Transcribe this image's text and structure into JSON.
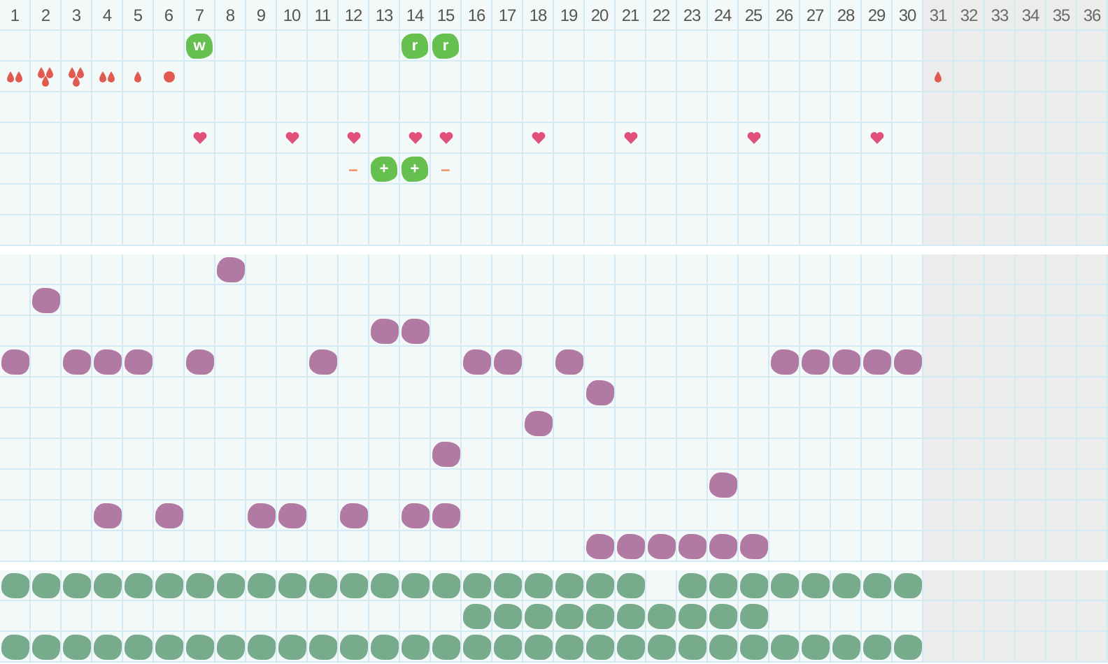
{
  "days": [
    {
      "label": "1",
      "disabled": false
    },
    {
      "label": "2",
      "disabled": false
    },
    {
      "label": "3",
      "disabled": false
    },
    {
      "label": "4",
      "disabled": false
    },
    {
      "label": "5",
      "disabled": false
    },
    {
      "label": "6",
      "disabled": false
    },
    {
      "label": "7",
      "disabled": false
    },
    {
      "label": "8",
      "disabled": false
    },
    {
      "label": "9",
      "disabled": false
    },
    {
      "label": "10",
      "disabled": false
    },
    {
      "label": "11",
      "disabled": false
    },
    {
      "label": "12",
      "disabled": false
    },
    {
      "label": "13",
      "disabled": false
    },
    {
      "label": "14",
      "disabled": false
    },
    {
      "label": "15",
      "disabled": false
    },
    {
      "label": "16",
      "disabled": false
    },
    {
      "label": "17",
      "disabled": false
    },
    {
      "label": "18",
      "disabled": false
    },
    {
      "label": "19",
      "disabled": false
    },
    {
      "label": "20",
      "disabled": false
    },
    {
      "label": "21",
      "disabled": false
    },
    {
      "label": "22",
      "disabled": false
    },
    {
      "label": "23",
      "disabled": false
    },
    {
      "label": "24",
      "disabled": false
    },
    {
      "label": "25",
      "disabled": false
    },
    {
      "label": "26",
      "disabled": false
    },
    {
      "label": "27",
      "disabled": false
    },
    {
      "label": "28",
      "disabled": false
    },
    {
      "label": "29",
      "disabled": false
    },
    {
      "label": "30",
      "disabled": false
    },
    {
      "label": "31",
      "disabled": true
    },
    {
      "label": "32",
      "disabled": true
    },
    {
      "label": "33",
      "disabled": true
    },
    {
      "label": "34",
      "disabled": true
    },
    {
      "label": "35",
      "disabled": true
    },
    {
      "label": "36",
      "disabled": true
    }
  ],
  "symptoms": [
    {
      "cells": [
        {
          "kind": "none"
        },
        {
          "kind": "none"
        },
        {
          "kind": "none"
        },
        {
          "kind": "none"
        },
        {
          "kind": "none"
        },
        {
          "kind": "none"
        },
        {
          "kind": "badge",
          "text": "w"
        },
        {
          "kind": "none"
        },
        {
          "kind": "none"
        },
        {
          "kind": "none"
        },
        {
          "kind": "none"
        },
        {
          "kind": "none"
        },
        {
          "kind": "none"
        },
        {
          "kind": "badge",
          "text": "r"
        },
        {
          "kind": "badge",
          "text": "r"
        },
        {
          "kind": "none"
        },
        {
          "kind": "none"
        },
        {
          "kind": "none"
        },
        {
          "kind": "none"
        },
        {
          "kind": "none"
        },
        {
          "kind": "none"
        },
        {
          "kind": "none"
        },
        {
          "kind": "none"
        },
        {
          "kind": "none"
        },
        {
          "kind": "none"
        },
        {
          "kind": "none"
        },
        {
          "kind": "none"
        },
        {
          "kind": "none"
        },
        {
          "kind": "none"
        },
        {
          "kind": "none"
        },
        {
          "kind": "none"
        },
        {
          "kind": "none"
        },
        {
          "kind": "none"
        },
        {
          "kind": "none"
        },
        {
          "kind": "none"
        },
        {
          "kind": "none"
        }
      ]
    },
    {
      "cells": [
        {
          "kind": "double"
        },
        {
          "kind": "triple"
        },
        {
          "kind": "triple"
        },
        {
          "kind": "double"
        },
        {
          "kind": "single"
        },
        {
          "kind": "spot"
        },
        {
          "kind": "none"
        },
        {
          "kind": "none"
        },
        {
          "kind": "none"
        },
        {
          "kind": "none"
        },
        {
          "kind": "none"
        },
        {
          "kind": "none"
        },
        {
          "kind": "none"
        },
        {
          "kind": "none"
        },
        {
          "kind": "none"
        },
        {
          "kind": "none"
        },
        {
          "kind": "none"
        },
        {
          "kind": "none"
        },
        {
          "kind": "none"
        },
        {
          "kind": "none"
        },
        {
          "kind": "none"
        },
        {
          "kind": "none"
        },
        {
          "kind": "none"
        },
        {
          "kind": "none"
        },
        {
          "kind": "none"
        },
        {
          "kind": "none"
        },
        {
          "kind": "none"
        },
        {
          "kind": "none"
        },
        {
          "kind": "none"
        },
        {
          "kind": "none"
        },
        {
          "kind": "single"
        },
        {
          "kind": "none"
        },
        {
          "kind": "none"
        },
        {
          "kind": "none"
        },
        {
          "kind": "none"
        },
        {
          "kind": "none"
        }
      ]
    },
    {
      "cells": [
        {
          "kind": "none"
        },
        {
          "kind": "none"
        },
        {
          "kind": "none"
        },
        {
          "kind": "none"
        },
        {
          "kind": "none"
        },
        {
          "kind": "none"
        },
        {
          "kind": "none"
        },
        {
          "kind": "none"
        },
        {
          "kind": "none"
        },
        {
          "kind": "none"
        },
        {
          "kind": "none"
        },
        {
          "kind": "none"
        },
        {
          "kind": "none"
        },
        {
          "kind": "none"
        },
        {
          "kind": "none"
        },
        {
          "kind": "none"
        },
        {
          "kind": "none"
        },
        {
          "kind": "none"
        },
        {
          "kind": "none"
        },
        {
          "kind": "none"
        },
        {
          "kind": "none"
        },
        {
          "kind": "none"
        },
        {
          "kind": "none"
        },
        {
          "kind": "none"
        },
        {
          "kind": "none"
        },
        {
          "kind": "none"
        },
        {
          "kind": "none"
        },
        {
          "kind": "none"
        },
        {
          "kind": "none"
        },
        {
          "kind": "none"
        },
        {
          "kind": "none"
        },
        {
          "kind": "none"
        },
        {
          "kind": "none"
        },
        {
          "kind": "none"
        },
        {
          "kind": "none"
        },
        {
          "kind": "none"
        }
      ]
    },
    {
      "cells": [
        {
          "kind": "none"
        },
        {
          "kind": "none"
        },
        {
          "kind": "none"
        },
        {
          "kind": "none"
        },
        {
          "kind": "none"
        },
        {
          "kind": "none"
        },
        {
          "kind": "heart"
        },
        {
          "kind": "none"
        },
        {
          "kind": "none"
        },
        {
          "kind": "heart"
        },
        {
          "kind": "none"
        },
        {
          "kind": "heart"
        },
        {
          "kind": "none"
        },
        {
          "kind": "heart"
        },
        {
          "kind": "heart"
        },
        {
          "kind": "none"
        },
        {
          "kind": "none"
        },
        {
          "kind": "heart"
        },
        {
          "kind": "none"
        },
        {
          "kind": "none"
        },
        {
          "kind": "heart"
        },
        {
          "kind": "none"
        },
        {
          "kind": "none"
        },
        {
          "kind": "none"
        },
        {
          "kind": "heart"
        },
        {
          "kind": "none"
        },
        {
          "kind": "none"
        },
        {
          "kind": "none"
        },
        {
          "kind": "heart"
        },
        {
          "kind": "none"
        },
        {
          "kind": "none"
        },
        {
          "kind": "none"
        },
        {
          "kind": "none"
        },
        {
          "kind": "none"
        },
        {
          "kind": "none"
        },
        {
          "kind": "none"
        }
      ]
    },
    {
      "cells": [
        {
          "kind": "none"
        },
        {
          "kind": "none"
        },
        {
          "kind": "none"
        },
        {
          "kind": "none"
        },
        {
          "kind": "none"
        },
        {
          "kind": "none"
        },
        {
          "kind": "none"
        },
        {
          "kind": "none"
        },
        {
          "kind": "none"
        },
        {
          "kind": "none"
        },
        {
          "kind": "none"
        },
        {
          "kind": "sign",
          "text": "–"
        },
        {
          "kind": "badge",
          "text": "+"
        },
        {
          "kind": "badge",
          "text": "+"
        },
        {
          "kind": "sign",
          "text": "–"
        },
        {
          "kind": "none"
        },
        {
          "kind": "none"
        },
        {
          "kind": "none"
        },
        {
          "kind": "none"
        },
        {
          "kind": "none"
        },
        {
          "kind": "none"
        },
        {
          "kind": "none"
        },
        {
          "kind": "none"
        },
        {
          "kind": "none"
        },
        {
          "kind": "none"
        },
        {
          "kind": "none"
        },
        {
          "kind": "none"
        },
        {
          "kind": "none"
        },
        {
          "kind": "none"
        },
        {
          "kind": "none"
        },
        {
          "kind": "none"
        },
        {
          "kind": "none"
        },
        {
          "kind": "none"
        },
        {
          "kind": "none"
        },
        {
          "kind": "none"
        },
        {
          "kind": "none"
        }
      ]
    },
    {
      "cells": [
        {
          "kind": "none"
        },
        {
          "kind": "none"
        },
        {
          "kind": "none"
        },
        {
          "kind": "none"
        },
        {
          "kind": "none"
        },
        {
          "kind": "none"
        },
        {
          "kind": "none"
        },
        {
          "kind": "none"
        },
        {
          "kind": "none"
        },
        {
          "kind": "none"
        },
        {
          "kind": "none"
        },
        {
          "kind": "none"
        },
        {
          "kind": "none"
        },
        {
          "kind": "none"
        },
        {
          "kind": "none"
        },
        {
          "kind": "none"
        },
        {
          "kind": "none"
        },
        {
          "kind": "none"
        },
        {
          "kind": "none"
        },
        {
          "kind": "none"
        },
        {
          "kind": "none"
        },
        {
          "kind": "none"
        },
        {
          "kind": "none"
        },
        {
          "kind": "none"
        },
        {
          "kind": "none"
        },
        {
          "kind": "none"
        },
        {
          "kind": "none"
        },
        {
          "kind": "none"
        },
        {
          "kind": "none"
        },
        {
          "kind": "none"
        },
        {
          "kind": "none"
        },
        {
          "kind": "none"
        },
        {
          "kind": "none"
        },
        {
          "kind": "none"
        },
        {
          "kind": "none"
        },
        {
          "kind": "none"
        }
      ]
    },
    {
      "cells": [
        {
          "kind": "none"
        },
        {
          "kind": "none"
        },
        {
          "kind": "none"
        },
        {
          "kind": "none"
        },
        {
          "kind": "none"
        },
        {
          "kind": "none"
        },
        {
          "kind": "none"
        },
        {
          "kind": "none"
        },
        {
          "kind": "none"
        },
        {
          "kind": "none"
        },
        {
          "kind": "none"
        },
        {
          "kind": "none"
        },
        {
          "kind": "none"
        },
        {
          "kind": "none"
        },
        {
          "kind": "none"
        },
        {
          "kind": "none"
        },
        {
          "kind": "none"
        },
        {
          "kind": "none"
        },
        {
          "kind": "none"
        },
        {
          "kind": "none"
        },
        {
          "kind": "none"
        },
        {
          "kind": "none"
        },
        {
          "kind": "none"
        },
        {
          "kind": "none"
        },
        {
          "kind": "none"
        },
        {
          "kind": "none"
        },
        {
          "kind": "none"
        },
        {
          "kind": "none"
        },
        {
          "kind": "none"
        },
        {
          "kind": "none"
        },
        {
          "kind": "none"
        },
        {
          "kind": "none"
        },
        {
          "kind": "none"
        },
        {
          "kind": "none"
        },
        {
          "kind": "none"
        },
        {
          "kind": "none"
        }
      ]
    }
  ],
  "moods": [
    {
      "filled": [
        false,
        false,
        false,
        false,
        false,
        false,
        false,
        true,
        false,
        false,
        false,
        false,
        false,
        false,
        false,
        false,
        false,
        false,
        false,
        false,
        false,
        false,
        false,
        false,
        false,
        false,
        false,
        false,
        false,
        false,
        false,
        false,
        false,
        false,
        false,
        false
      ]
    },
    {
      "filled": [
        false,
        true,
        false,
        false,
        false,
        false,
        false,
        false,
        false,
        false,
        false,
        false,
        false,
        false,
        false,
        false,
        false,
        false,
        false,
        false,
        false,
        false,
        false,
        false,
        false,
        false,
        false,
        false,
        false,
        false,
        false,
        false,
        false,
        false,
        false,
        false
      ]
    },
    {
      "filled": [
        false,
        false,
        false,
        false,
        false,
        false,
        false,
        false,
        false,
        false,
        false,
        false,
        true,
        true,
        false,
        false,
        false,
        false,
        false,
        false,
        false,
        false,
        false,
        false,
        false,
        false,
        false,
        false,
        false,
        false,
        false,
        false,
        false,
        false,
        false,
        false
      ]
    },
    {
      "filled": [
        true,
        false,
        true,
        true,
        true,
        false,
        true,
        false,
        false,
        false,
        true,
        false,
        false,
        false,
        false,
        true,
        true,
        false,
        true,
        false,
        false,
        false,
        false,
        false,
        false,
        true,
        true,
        true,
        true,
        true,
        false,
        false,
        false,
        false,
        false,
        false
      ]
    },
    {
      "filled": [
        false,
        false,
        false,
        false,
        false,
        false,
        false,
        false,
        false,
        false,
        false,
        false,
        false,
        false,
        false,
        false,
        false,
        false,
        false,
        true,
        false,
        false,
        false,
        false,
        false,
        false,
        false,
        false,
        false,
        false,
        false,
        false,
        false,
        false,
        false,
        false
      ]
    },
    {
      "filled": [
        false,
        false,
        false,
        false,
        false,
        false,
        false,
        false,
        false,
        false,
        false,
        false,
        false,
        false,
        false,
        false,
        false,
        true,
        false,
        false,
        false,
        false,
        false,
        false,
        false,
        false,
        false,
        false,
        false,
        false,
        false,
        false,
        false,
        false,
        false,
        false
      ]
    },
    {
      "filled": [
        false,
        false,
        false,
        false,
        false,
        false,
        false,
        false,
        false,
        false,
        false,
        false,
        false,
        false,
        true,
        false,
        false,
        false,
        false,
        false,
        false,
        false,
        false,
        false,
        false,
        false,
        false,
        false,
        false,
        false,
        false,
        false,
        false,
        false,
        false,
        false
      ]
    },
    {
      "filled": [
        false,
        false,
        false,
        false,
        false,
        false,
        false,
        false,
        false,
        false,
        false,
        false,
        false,
        false,
        false,
        false,
        false,
        false,
        false,
        false,
        false,
        false,
        false,
        true,
        false,
        false,
        false,
        false,
        false,
        false,
        false,
        false,
        false,
        false,
        false,
        false
      ]
    },
    {
      "filled": [
        false,
        false,
        false,
        true,
        false,
        true,
        false,
        false,
        true,
        true,
        false,
        true,
        false,
        true,
        true,
        false,
        false,
        false,
        false,
        false,
        false,
        false,
        false,
        false,
        false,
        false,
        false,
        false,
        false,
        false,
        false,
        false,
        false,
        false,
        false,
        false
      ]
    },
    {
      "filled": [
        false,
        false,
        false,
        false,
        false,
        false,
        false,
        false,
        false,
        false,
        false,
        false,
        false,
        false,
        false,
        false,
        false,
        false,
        false,
        true,
        true,
        true,
        true,
        true,
        true,
        false,
        false,
        false,
        false,
        false,
        false,
        false,
        false,
        false,
        false,
        false
      ]
    }
  ],
  "habits": [
    {
      "filled": [
        true,
        true,
        true,
        true,
        true,
        true,
        true,
        true,
        true,
        true,
        true,
        true,
        true,
        true,
        true,
        true,
        true,
        true,
        true,
        true,
        true,
        false,
        true,
        true,
        true,
        true,
        true,
        true,
        true,
        true,
        false,
        false,
        false,
        false,
        false,
        false
      ]
    },
    {
      "filled": [
        false,
        false,
        false,
        false,
        false,
        false,
        false,
        false,
        false,
        false,
        false,
        false,
        false,
        false,
        false,
        true,
        true,
        true,
        true,
        true,
        true,
        true,
        true,
        true,
        true,
        false,
        false,
        false,
        false,
        false,
        false,
        false,
        false,
        false,
        false,
        false
      ]
    },
    {
      "filled": [
        true,
        true,
        true,
        true,
        true,
        true,
        true,
        true,
        true,
        true,
        true,
        true,
        true,
        true,
        true,
        true,
        true,
        true,
        true,
        true,
        true,
        true,
        true,
        true,
        true,
        true,
        true,
        true,
        true,
        true,
        false,
        false,
        false,
        false,
        false,
        false
      ]
    }
  ]
}
